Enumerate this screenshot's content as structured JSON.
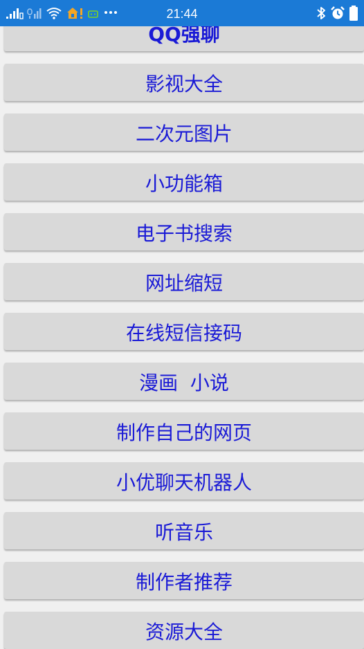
{
  "status_bar": {
    "time": "21:44",
    "bg_color": "#1b7ad6",
    "left_icons": [
      "signal-bars-icon",
      "signal-bars-2-icon",
      "wifi-icon",
      "home-alert-icon",
      "message-icon",
      "more-dots-icon"
    ],
    "right_icons": [
      "bluetooth-icon",
      "alarm-icon",
      "battery-icon"
    ]
  },
  "menu": {
    "text_color": "#1a1ad6",
    "button_color": "#d9d9d9",
    "items": [
      {
        "label": "QQ强聊"
      },
      {
        "label": "影视大全"
      },
      {
        "label": "二次元图片"
      },
      {
        "label": "小功能箱"
      },
      {
        "label": "电子书搜索"
      },
      {
        "label": "网址缩短"
      },
      {
        "label": "在线短信接码"
      },
      {
        "label": "漫画  小说"
      },
      {
        "label": "制作自己的网页"
      },
      {
        "label": "小优聊天机器人"
      },
      {
        "label": "听音乐"
      },
      {
        "label": "制作者推荐"
      },
      {
        "label": "资源大全"
      }
    ]
  }
}
